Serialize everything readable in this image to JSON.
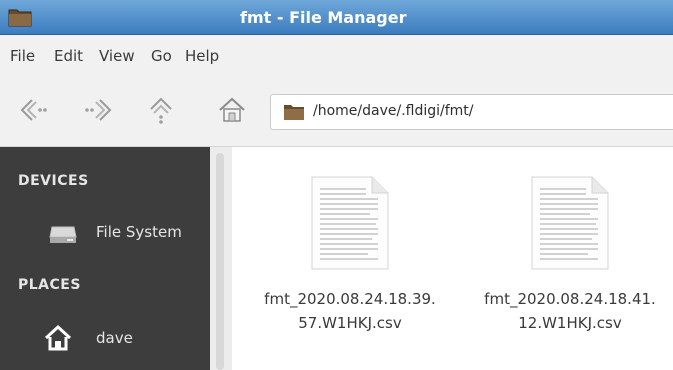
{
  "window": {
    "title": "fmt - File Manager"
  },
  "menubar": {
    "items": [
      "File",
      "Edit",
      "View",
      "Go",
      "Help"
    ]
  },
  "toolbar": {
    "path": "/home/dave/.fldigi/fmt/"
  },
  "sidebar": {
    "sections": [
      {
        "label": "DEVICES",
        "items": [
          {
            "label": "File System",
            "icon": "drive-icon"
          }
        ]
      },
      {
        "label": "PLACES",
        "items": [
          {
            "label": "dave",
            "icon": "home-icon"
          }
        ]
      }
    ]
  },
  "files": [
    {
      "name_line1": "fmt_2020.08.24.18.39.",
      "name_line2": "57.W1HKJ.csv",
      "icon": "document-icon"
    },
    {
      "name_line1": "fmt_2020.08.24.18.41.",
      "name_line2": "12.W1HKJ.csv",
      "icon": "document-icon"
    }
  ],
  "colors": {
    "titlebar": "#3c7dc0",
    "sidebar_bg": "#3d3d3d",
    "content_bg": "#ffffff"
  }
}
